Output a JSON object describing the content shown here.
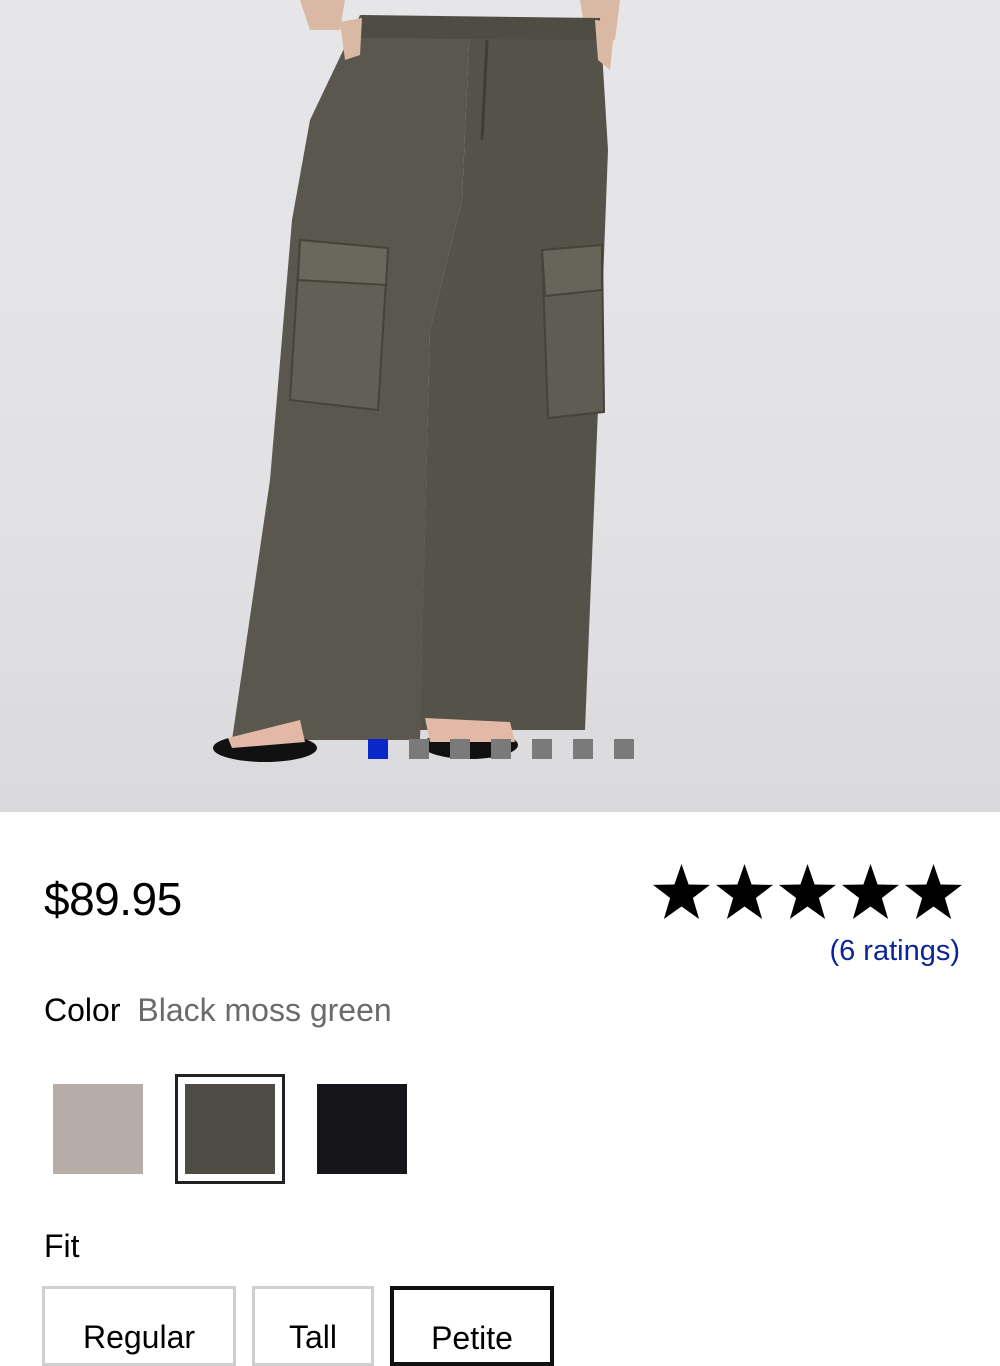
{
  "product": {
    "image_icon": "product-photo-cargo-pants",
    "carousel": {
      "count": 7,
      "active_index": 0,
      "active_color": "#0a28c8",
      "inactive_color": "#7a7a7a"
    },
    "price": "$89.95",
    "rating": {
      "stars": 5,
      "max": 5,
      "ratings_text": "(6 ratings)",
      "link_color": "#0b2496"
    },
    "color": {
      "label": "Color",
      "selected_name": "Black moss green",
      "swatches": [
        {
          "name": "swatch-taupe",
          "hex": "#b6aca8",
          "selected": false
        },
        {
          "name": "swatch-black-moss-green",
          "hex": "#4e4b44",
          "selected": true
        },
        {
          "name": "swatch-black",
          "hex": "#16161a",
          "selected": false
        }
      ]
    },
    "fit": {
      "label": "Fit",
      "options": [
        "Regular",
        "Tall",
        "Petite"
      ],
      "selected": "Petite"
    }
  }
}
